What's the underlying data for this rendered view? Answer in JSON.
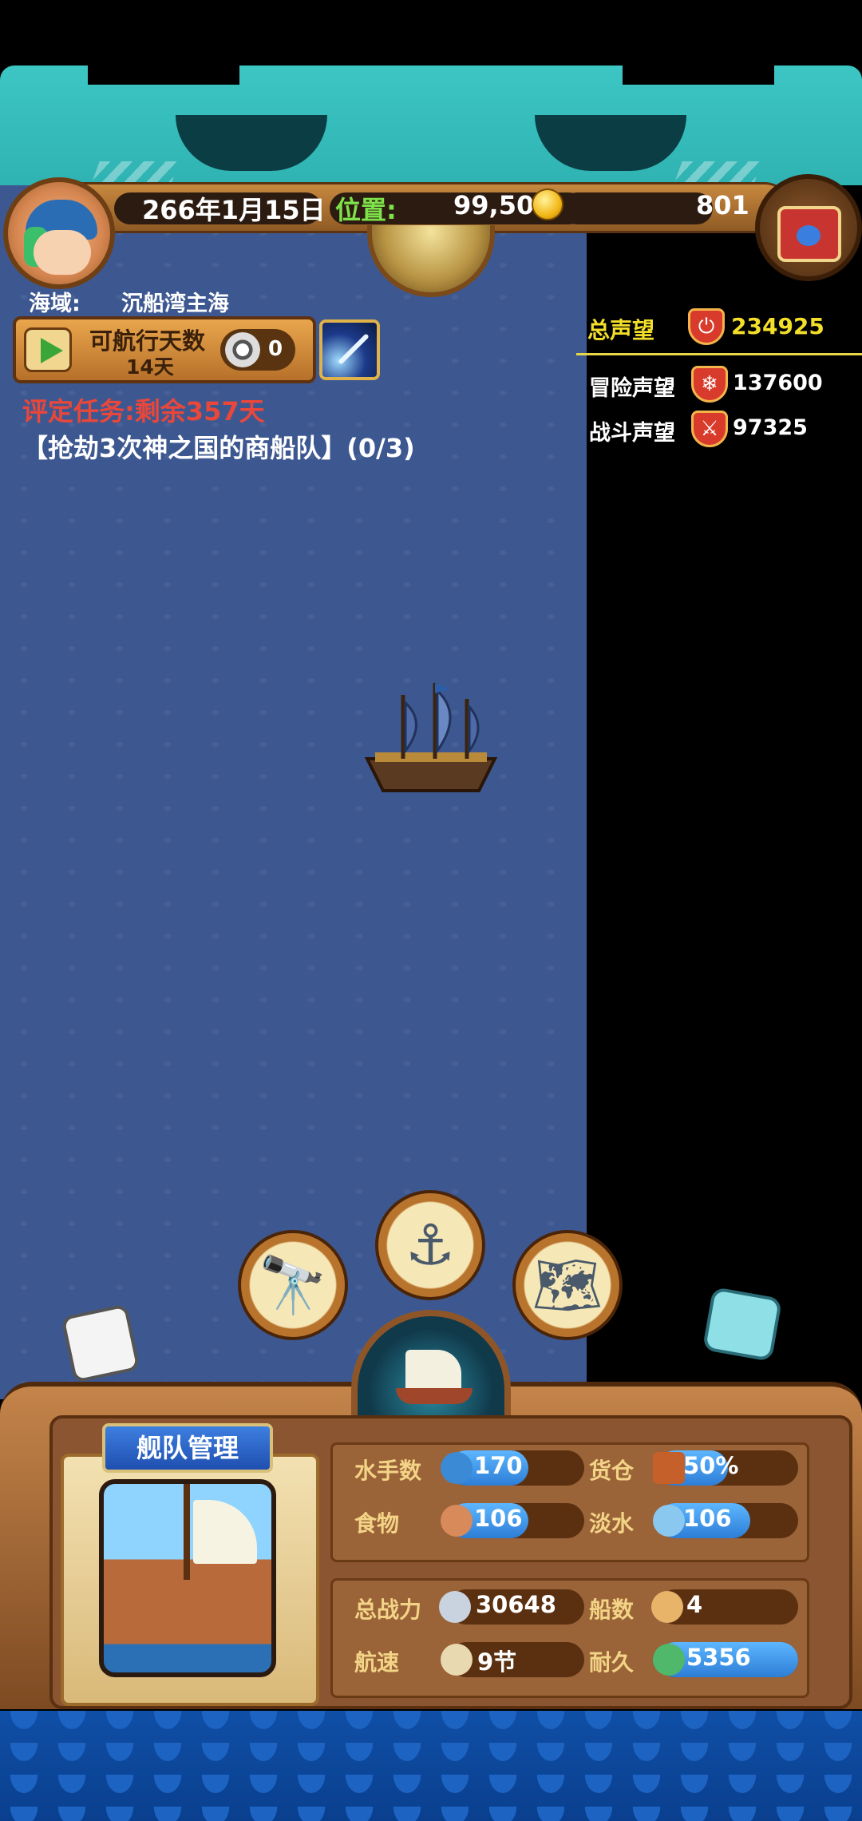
{
  "topbar": {
    "date": "266年1月15日",
    "position_label": "位置:",
    "position_value": "99,50",
    "gold": "801"
  },
  "sea": {
    "label": "海域:",
    "name": "沉船湾主海"
  },
  "voyage": {
    "label": "可航行天数",
    "days": "14天",
    "count": "0"
  },
  "task": {
    "remaining": "评定任务:剩余357天",
    "description": "【抢劫3次神之国的商船队】(0/3)"
  },
  "reputation": {
    "total_label": "总声望",
    "total_value": "234925",
    "adventure_label": "冒险声望",
    "adventure_value": "137600",
    "battle_label": "战斗声望",
    "battle_value": "97325"
  },
  "fleet": {
    "title": "舰队管理",
    "sailors_label": "水手数",
    "sailors_value": "170",
    "cargo_label": "货仓",
    "cargo_value": "50%",
    "cargo_fill": 0.5,
    "food_label": "食物",
    "food_value": "106",
    "water_label": "淡水",
    "water_value": "106",
    "power_label": "总战力",
    "power_value": "30648",
    "ships_label": "船数",
    "ships_value": "4",
    "speed_label": "航速",
    "speed_value": "9节",
    "durability_label": "耐久",
    "durability_value": "5356"
  },
  "colors": {
    "ocean": "#3d5891",
    "accent_yellow": "#f3df2a",
    "task_red": "#e9473a",
    "position_green": "#7ee34a"
  },
  "icons": {
    "spyglass": "spyglass-icon",
    "anchor": "anchor-icon",
    "map": "world-map-icon"
  }
}
